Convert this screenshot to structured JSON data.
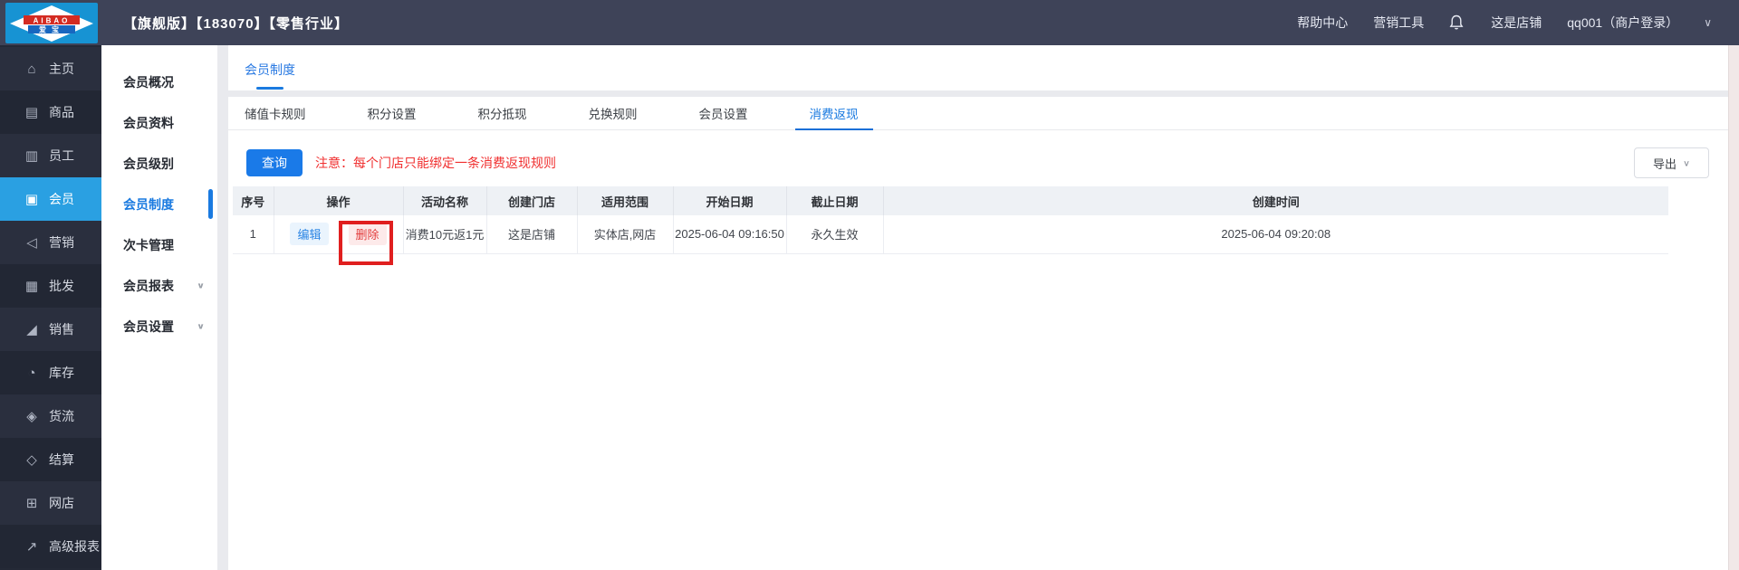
{
  "topbar": {
    "logo": {
      "line1": "AIBAO",
      "line2": "爱  宝"
    },
    "title": "【旗舰版】【183070】【零售行业】",
    "help": "帮助中心",
    "marketing_tools": "营销工具",
    "store_name": "这是店铺",
    "account": "qq001（商户登录）"
  },
  "icons": {
    "chevron_down": "∨"
  },
  "sidebar": {
    "items": [
      {
        "name": "home",
        "label": "主页",
        "icon": "⌂",
        "active": false
      },
      {
        "name": "goods",
        "label": "商品",
        "icon": "▤",
        "active": false
      },
      {
        "name": "staff",
        "label": "员工",
        "icon": "▥",
        "active": false
      },
      {
        "name": "member",
        "label": "会员",
        "icon": "▣",
        "active": true
      },
      {
        "name": "marketing",
        "label": "营销",
        "icon": "◁",
        "active": false
      },
      {
        "name": "wholesale",
        "label": "批发",
        "icon": "▦",
        "active": false
      },
      {
        "name": "sales",
        "label": "销售",
        "icon": "◢",
        "active": false
      },
      {
        "name": "inventory",
        "label": "库存",
        "icon": "◔",
        "active": false
      },
      {
        "name": "logistics",
        "label": "货流",
        "icon": "◈",
        "active": false
      },
      {
        "name": "settlement",
        "label": "结算",
        "icon": "◇",
        "active": false
      },
      {
        "name": "online-store",
        "label": "网店",
        "icon": "⊞",
        "active": false
      },
      {
        "name": "advanced-reports",
        "label": "高级报表",
        "icon": "↗",
        "active": false
      }
    ]
  },
  "submenu": {
    "items": [
      {
        "name": "member-overview",
        "label": "会员概况",
        "active": false,
        "expandable": false
      },
      {
        "name": "member-info",
        "label": "会员资料",
        "active": false,
        "expandable": false
      },
      {
        "name": "member-level",
        "label": "会员级别",
        "active": false,
        "expandable": false
      },
      {
        "name": "member-system",
        "label": "会员制度",
        "active": true,
        "expandable": false
      },
      {
        "name": "times-card",
        "label": "次卡管理",
        "active": false,
        "expandable": false
      },
      {
        "name": "member-reports",
        "label": "会员报表",
        "active": false,
        "expandable": true
      },
      {
        "name": "member-settings",
        "label": "会员设置",
        "active": false,
        "expandable": true
      }
    ]
  },
  "page_tab": {
    "label": "会员制度"
  },
  "subtabs": {
    "items": [
      {
        "name": "stored-card-rules",
        "label": "储值卡规则",
        "active": false
      },
      {
        "name": "points-settings",
        "label": "积分设置",
        "active": false
      },
      {
        "name": "points-redeem",
        "label": "积分抵现",
        "active": false
      },
      {
        "name": "exchange-rules",
        "label": "兑换规则",
        "active": false
      },
      {
        "name": "member-settings",
        "label": "会员设置",
        "active": false
      },
      {
        "name": "consume-cashback",
        "label": "消费返现",
        "active": true
      }
    ]
  },
  "toolbar": {
    "query_label": "查询",
    "notice": "注意：每个门店只能绑定一条消费返现规则",
    "export_label": "导出"
  },
  "table": {
    "headers": [
      "序号",
      "操作",
      "活动名称",
      "创建门店",
      "适用范围",
      "开始日期",
      "截止日期",
      "创建时间"
    ],
    "row": {
      "index": "1",
      "edit_label": "编辑",
      "delete_label": "删除",
      "activity_name": "消费10元返1元",
      "created_store": "这是店铺",
      "scope": "实体店,网店",
      "start_date": "2025-06-04 09:16:50",
      "end_date": "永久生效",
      "created_time": "2025-06-04 09:20:08"
    }
  },
  "colors": {
    "accent_blue": "#1a7ae0",
    "sidebar_active_blue": "#2aa0e2",
    "notice_red": "#f03030",
    "annotation_red": "#e01f1f",
    "logo_blue": "#1793d3",
    "logo_red": "#d42b22"
  }
}
